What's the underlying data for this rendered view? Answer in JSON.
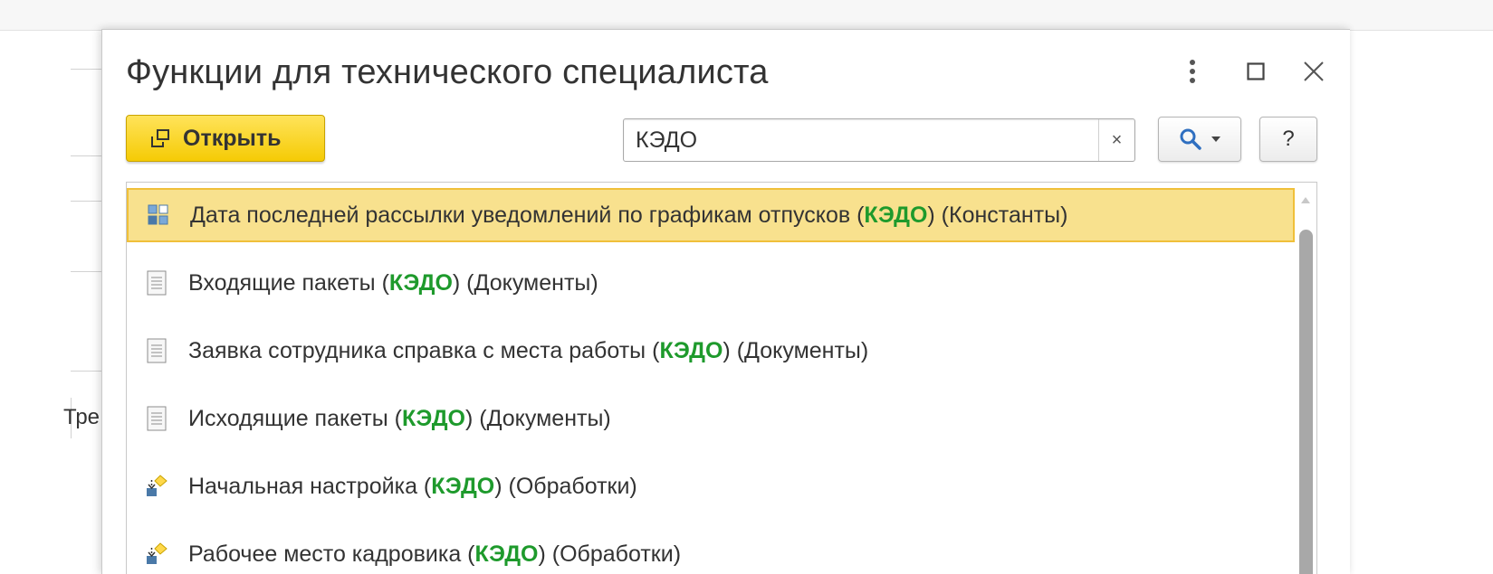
{
  "background": {
    "tab_text": "Тре"
  },
  "dialog": {
    "title": "Функции для технического специалиста",
    "toolbar": {
      "open_label": "Открыть",
      "search_value": "КЭДО",
      "search_clear": "×",
      "help_label": "?"
    },
    "items": [
      {
        "pre": "Дата последней рассылки уведомлений по графикам отпусков (",
        "match": "КЭДО",
        "post": ") (Константы)",
        "icon": "constant-icon",
        "selected": true
      },
      {
        "pre": "Входящие пакеты (",
        "match": "КЭДО",
        "post": ") (Документы)",
        "icon": "document-icon",
        "selected": false
      },
      {
        "pre": "Заявка сотрудника справка с места работы (",
        "match": "КЭДО",
        "post": ") (Документы)",
        "icon": "document-icon",
        "selected": false
      },
      {
        "pre": "Исходящие пакеты (",
        "match": "КЭДО",
        "post": ") (Документы)",
        "icon": "document-icon",
        "selected": false
      },
      {
        "pre": "Начальная настройка (",
        "match": "КЭДО",
        "post": ") (Обработки)",
        "icon": "dataprocessor-icon",
        "selected": false
      },
      {
        "pre": "Рабочее место кадровика (",
        "match": "КЭДО",
        "post": ") (Обработки)",
        "icon": "dataprocessor-icon",
        "selected": false
      }
    ]
  },
  "colors": {
    "highlight_text": "#1e9a2c",
    "selection_fill": "#f8e18e",
    "selection_border": "#f0c03a",
    "open_button": "#f5cb05"
  }
}
